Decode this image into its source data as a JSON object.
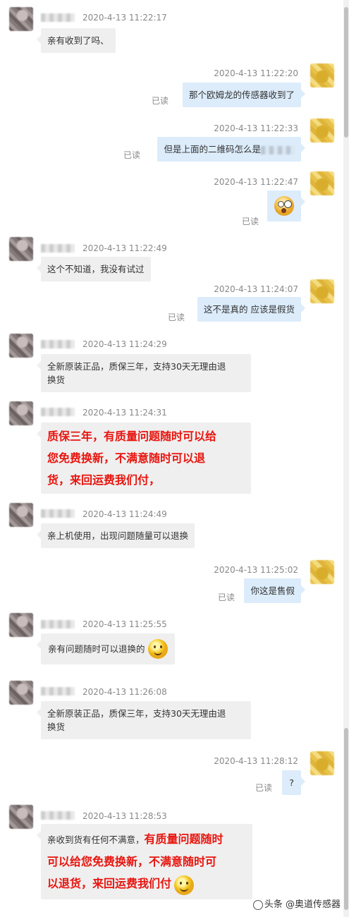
{
  "messages": [
    {
      "time": "2020-4-13 11:22:17",
      "text": "亲有收到了吗、"
    },
    {
      "time": "2020-4-13 11:22:20",
      "text": "那个欧姆龙的传感器收到了",
      "read": "已读"
    },
    {
      "time": "2020-4-13 11:22:33",
      "text": "但是上面的二维码怎么是",
      "read": "已读"
    },
    {
      "time": "2020-4-13 11:22:47",
      "read": "已读"
    },
    {
      "time": "2020-4-13 11:22:49",
      "text": "这个不知道，我没有试过"
    },
    {
      "time": "2020-4-13 11:24:07",
      "text": "这不是真的 应该是假货",
      "read": "已读"
    },
    {
      "time": "2020-4-13 11:24:29",
      "line1": "全新原装正品，质保三年，支持30天无理由退",
      "line2": "换货"
    },
    {
      "time": "2020-4-13 11:24:31",
      "line1": "质保三年，有质量问题随时可以给",
      "line2": "您免费换新，不满意随时可以退",
      "line3": "货，来回运费我们付，"
    },
    {
      "time": "2020-4-13 11:24:49",
      "text": "亲上机使用，出现问题随量可以退换"
    },
    {
      "time": "2020-4-13 11:25:02",
      "text": "你这是售假",
      "read": "已读"
    },
    {
      "time": "2020-4-13 11:25:55",
      "text": "亲有问题随时可以退换的"
    },
    {
      "time": "2020-4-13 11:26:08",
      "line1": "全新原装正品，质保三年，支持30天无理由退",
      "line2": "换货"
    },
    {
      "time": "2020-4-13 11:28:12",
      "text": "?",
      "read": "已读"
    },
    {
      "time": "2020-4-13 11:28:53",
      "prefix": "亲收到货有任何不满意，",
      "red1": "有质量问题随时",
      "line2": "可以给您免费换新，不满意随时可",
      "line3": "以退货，来回运费我们付"
    }
  ],
  "watermark": "头条 @奥道传感器"
}
